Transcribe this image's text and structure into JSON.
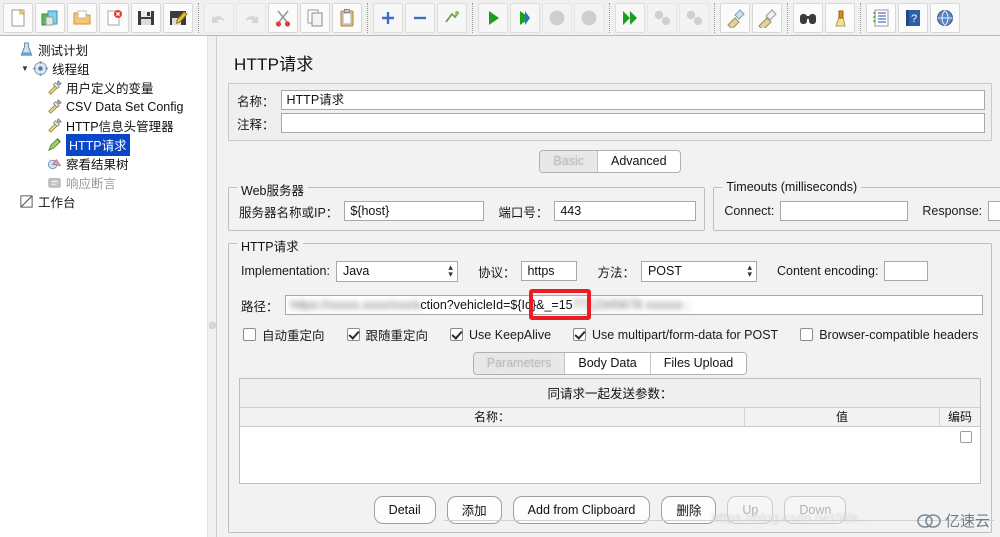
{
  "toolbar": {
    "groups": [
      {
        "buttons": [
          {
            "name": "new-button",
            "icon": "new-file-icon",
            "disabled": false
          },
          {
            "name": "templates-button",
            "icon": "templates-icon",
            "disabled": false
          },
          {
            "name": "open-button",
            "icon": "open-folder-icon",
            "disabled": false
          },
          {
            "name": "close-button",
            "icon": "close-file-icon",
            "disabled": false
          },
          {
            "name": "save-button",
            "icon": "save-floppy-icon",
            "disabled": false
          },
          {
            "name": "save-as-button",
            "icon": "save-as-icon",
            "disabled": false
          }
        ]
      },
      {
        "buttons": [
          {
            "name": "undo-button",
            "icon": "undo-arrow-icon",
            "disabled": true
          },
          {
            "name": "redo-button",
            "icon": "redo-arrow-icon",
            "disabled": true
          },
          {
            "name": "cut-button",
            "icon": "scissors-icon",
            "disabled": false
          },
          {
            "name": "copy-button",
            "icon": "copy-pages-icon",
            "disabled": false
          },
          {
            "name": "paste-button",
            "icon": "clipboard-icon",
            "disabled": false
          }
        ]
      },
      {
        "buttons": [
          {
            "name": "expand-all-button",
            "icon": "plus-icon",
            "disabled": false
          },
          {
            "name": "collapse-all-button",
            "icon": "minus-icon",
            "disabled": false
          },
          {
            "name": "toggle-button",
            "icon": "toggle-icon",
            "disabled": false
          }
        ]
      },
      {
        "buttons": [
          {
            "name": "start-button",
            "icon": "play-green-icon",
            "disabled": false
          },
          {
            "name": "start-no-pauses-button",
            "icon": "play-no-pause-icon",
            "disabled": false
          },
          {
            "name": "stop-button",
            "icon": "stop-grey-icon",
            "disabled": true
          },
          {
            "name": "shutdown-button",
            "icon": "shutdown-grey-icon",
            "disabled": true
          }
        ]
      },
      {
        "buttons": [
          {
            "name": "remote-start-all-button",
            "icon": "remote-start-icon",
            "disabled": false
          },
          {
            "name": "remote-stop-all-button",
            "icon": "remote-stop-icon",
            "disabled": true
          },
          {
            "name": "remote-shutdown-all-button",
            "icon": "remote-shutdown-icon",
            "disabled": true
          }
        ]
      },
      {
        "buttons": [
          {
            "name": "clear-button",
            "icon": "clear-broom-icon",
            "disabled": false
          },
          {
            "name": "clear-all-button",
            "icon": "clear-all-broom-icon",
            "disabled": false
          }
        ]
      },
      {
        "buttons": [
          {
            "name": "search-button",
            "icon": "binoculars-icon",
            "disabled": false
          },
          {
            "name": "reset-search-button",
            "icon": "reset-search-broom-icon",
            "disabled": false
          }
        ]
      },
      {
        "buttons": [
          {
            "name": "function-helper-button",
            "icon": "function-list-icon",
            "disabled": false
          },
          {
            "name": "help-button",
            "icon": "help-book-icon",
            "disabled": false
          },
          {
            "name": "extra-button",
            "icon": "globe-icon",
            "disabled": false
          }
        ]
      }
    ]
  },
  "tree": {
    "items": [
      {
        "label": "测试计划",
        "icon": "test-plan-icon",
        "indent": 0,
        "twisty": "",
        "state": "normal",
        "name": "tree-item-test-plan"
      },
      {
        "label": "线程组",
        "icon": "thread-group-icon",
        "indent": 1,
        "twisty": "▼",
        "state": "normal",
        "name": "tree-item-thread-group"
      },
      {
        "label": "用户定义的变量",
        "icon": "config-wrench-icon",
        "indent": 2,
        "twisty": "",
        "state": "normal",
        "name": "tree-item-user-defined-variables"
      },
      {
        "label": "CSV Data Set Config",
        "icon": "config-wrench-icon",
        "indent": 2,
        "twisty": "",
        "state": "normal",
        "name": "tree-item-csv-data-set-config"
      },
      {
        "label": "HTTP信息头管理器",
        "icon": "config-wrench-icon",
        "indent": 2,
        "twisty": "",
        "state": "normal",
        "name": "tree-item-http-header-manager"
      },
      {
        "label": "HTTP请求",
        "icon": "http-sampler-icon",
        "indent": 2,
        "twisty": "",
        "state": "selected",
        "name": "tree-item-http-request"
      },
      {
        "label": "察看结果树",
        "icon": "view-results-tree-icon",
        "indent": 2,
        "twisty": "",
        "state": "normal",
        "name": "tree-item-view-results-tree"
      },
      {
        "label": "响应断言",
        "icon": "assertion-icon",
        "indent": 2,
        "twisty": "",
        "state": "disabled",
        "name": "tree-item-response-assertion"
      },
      {
        "label": "工作台",
        "icon": "workbench-icon",
        "indent": 0,
        "twisty": "",
        "state": "normal",
        "name": "tree-item-workbench"
      }
    ]
  },
  "main": {
    "panel_title": "HTTP请求",
    "name_label": "名称：",
    "name_value": "HTTP请求",
    "comment_label": "注释：",
    "comment_value": "",
    "top_tabs": [
      {
        "label": "Basic",
        "selected": true,
        "name": "tab-basic"
      },
      {
        "label": "Advanced",
        "selected": false,
        "name": "tab-advanced"
      }
    ],
    "webserver": {
      "group_title": "Web服务器",
      "server_label": "服务器名称或IP：",
      "server_value": "${host}",
      "port_label": "端口号：",
      "port_value": "443"
    },
    "timeouts": {
      "group_title": "Timeouts (milliseconds)",
      "connect_label": "Connect:",
      "connect_value": "",
      "response_label": "Response:",
      "response_value": ""
    },
    "httprequest": {
      "group_title": "HTTP请求",
      "implementation_label": "Implementation:",
      "implementation_value": "Java",
      "protocol_label": "协议：",
      "protocol_value": "https",
      "method_label": "方法：",
      "method_value": "POST",
      "content_encoding_label": "Content encoding:",
      "content_encoding_value": "",
      "path_label": "路径：",
      "path_prefix_redacted": "https://xxxxx.xxxx/xxx/a",
      "path_visible": "ction?vehicleId=${Id}&_=15",
      "path_suffix_redacted": "7712345678 xxxxxx ;",
      "highlight_color": "#ed1c24",
      "checkboxes": [
        {
          "label": "自动重定向",
          "checked": false,
          "name": "checkbox-auto-redirect"
        },
        {
          "label": "跟随重定向",
          "checked": true,
          "name": "checkbox-follow-redirects"
        },
        {
          "label": "Use KeepAlive",
          "checked": true,
          "name": "checkbox-use-keepalive"
        },
        {
          "label": "Use multipart/form-data for POST",
          "checked": true,
          "name": "checkbox-use-multipart"
        },
        {
          "label": "Browser-compatible headers",
          "checked": false,
          "name": "checkbox-browser-compatible-headers"
        }
      ],
      "body_tabs": [
        {
          "label": "Parameters",
          "selected": true,
          "name": "tab-parameters"
        },
        {
          "label": "Body Data",
          "selected": false,
          "name": "tab-body-data"
        },
        {
          "label": "Files Upload",
          "selected": false,
          "name": "tab-files-upload"
        }
      ],
      "table": {
        "caption": "同请求一起发送参数：",
        "columns": [
          "名称：",
          "值",
          "编码"
        ],
        "rows": []
      },
      "buttons": [
        {
          "label": "Detail",
          "disabled": false,
          "name": "detail-button"
        },
        {
          "label": "添加",
          "disabled": false,
          "name": "add-button"
        },
        {
          "label": "Add from Clipboard",
          "disabled": false,
          "name": "add-from-clipboard-button"
        },
        {
          "label": "删除",
          "disabled": false,
          "name": "delete-button"
        },
        {
          "label": "Up",
          "disabled": true,
          "name": "up-button"
        },
        {
          "label": "Down",
          "disabled": true,
          "name": "down-button"
        }
      ]
    }
  },
  "watermark": {
    "url_text": "https://blog.csdn.net/We...",
    "logo_text": "亿速云"
  }
}
